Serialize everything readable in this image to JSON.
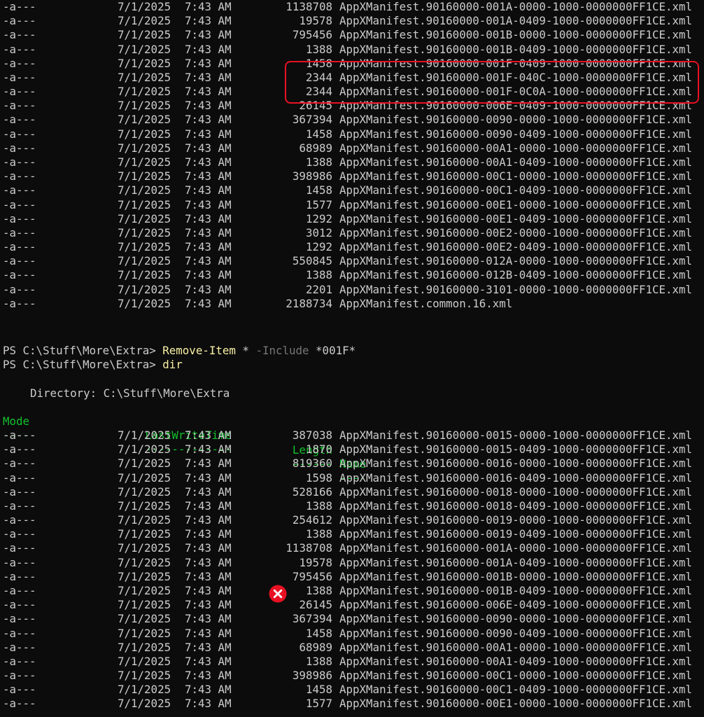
{
  "colors": {
    "background": "#0c0c0c",
    "text": "#cccccc",
    "header_green": "#13c12e",
    "command_yellow": "#f9f1a5",
    "param_gray": "#767676",
    "highlight_red": "#e81123"
  },
  "top_listing": [
    {
      "mode": "-a---",
      "date": "7/1/2025",
      "time": "7:43 AM",
      "length": "1138708",
      "name": "AppXManifest.90160000-001A-0000-1000-0000000FF1CE.xml"
    },
    {
      "mode": "-a---",
      "date": "7/1/2025",
      "time": "7:43 AM",
      "length": "19578",
      "name": "AppXManifest.90160000-001A-0409-1000-0000000FF1CE.xml"
    },
    {
      "mode": "-a---",
      "date": "7/1/2025",
      "time": "7:43 AM",
      "length": "795456",
      "name": "AppXManifest.90160000-001B-0000-1000-0000000FF1CE.xml"
    },
    {
      "mode": "-a---",
      "date": "7/1/2025",
      "time": "7:43 AM",
      "length": "1388",
      "name": "AppXManifest.90160000-001B-0409-1000-0000000FF1CE.xml"
    },
    {
      "mode": "-a---",
      "date": "7/1/2025",
      "time": "7:43 AM",
      "length": "1458",
      "name": "AppXManifest.90160000-001F-0409-1000-0000000FF1CE.xml"
    },
    {
      "mode": "-a---",
      "date": "7/1/2025",
      "time": "7:43 AM",
      "length": "2344",
      "name": "AppXManifest.90160000-001F-040C-1000-0000000FF1CE.xml"
    },
    {
      "mode": "-a---",
      "date": "7/1/2025",
      "time": "7:43 AM",
      "length": "2344",
      "name": "AppXManifest.90160000-001F-0C0A-1000-0000000FF1CE.xml"
    },
    {
      "mode": "-a---",
      "date": "7/1/2025",
      "time": "7:43 AM",
      "length": "26145",
      "name": "AppXManifest.90160000-006E-0409-1000-0000000FF1CE.xml"
    },
    {
      "mode": "-a---",
      "date": "7/1/2025",
      "time": "7:43 AM",
      "length": "367394",
      "name": "AppXManifest.90160000-0090-0000-1000-0000000FF1CE.xml"
    },
    {
      "mode": "-a---",
      "date": "7/1/2025",
      "time": "7:43 AM",
      "length": "1458",
      "name": "AppXManifest.90160000-0090-0409-1000-0000000FF1CE.xml"
    },
    {
      "mode": "-a---",
      "date": "7/1/2025",
      "time": "7:43 AM",
      "length": "68989",
      "name": "AppXManifest.90160000-00A1-0000-1000-0000000FF1CE.xml"
    },
    {
      "mode": "-a---",
      "date": "7/1/2025",
      "time": "7:43 AM",
      "length": "1388",
      "name": "AppXManifest.90160000-00A1-0409-1000-0000000FF1CE.xml"
    },
    {
      "mode": "-a---",
      "date": "7/1/2025",
      "time": "7:43 AM",
      "length": "398986",
      "name": "AppXManifest.90160000-00C1-0000-1000-0000000FF1CE.xml"
    },
    {
      "mode": "-a---",
      "date": "7/1/2025",
      "time": "7:43 AM",
      "length": "1458",
      "name": "AppXManifest.90160000-00C1-0409-1000-0000000FF1CE.xml"
    },
    {
      "mode": "-a---",
      "date": "7/1/2025",
      "time": "7:43 AM",
      "length": "1577",
      "name": "AppXManifest.90160000-00E1-0000-1000-0000000FF1CE.xml"
    },
    {
      "mode": "-a---",
      "date": "7/1/2025",
      "time": "7:43 AM",
      "length": "1292",
      "name": "AppXManifest.90160000-00E1-0409-1000-0000000FF1CE.xml"
    },
    {
      "mode": "-a---",
      "date": "7/1/2025",
      "time": "7:43 AM",
      "length": "3012",
      "name": "AppXManifest.90160000-00E2-0000-1000-0000000FF1CE.xml"
    },
    {
      "mode": "-a---",
      "date": "7/1/2025",
      "time": "7:43 AM",
      "length": "1292",
      "name": "AppXManifest.90160000-00E2-0409-1000-0000000FF1CE.xml"
    },
    {
      "mode": "-a---",
      "date": "7/1/2025",
      "time": "7:43 AM",
      "length": "550845",
      "name": "AppXManifest.90160000-012A-0000-1000-0000000FF1CE.xml"
    },
    {
      "mode": "-a---",
      "date": "7/1/2025",
      "time": "7:43 AM",
      "length": "1388",
      "name": "AppXManifest.90160000-012B-0409-1000-0000000FF1CE.xml"
    },
    {
      "mode": "-a---",
      "date": "7/1/2025",
      "time": "7:43 AM",
      "length": "2201",
      "name": "AppXManifest.90160000-3101-0000-1000-0000000FF1CE.xml"
    },
    {
      "mode": "-a---",
      "date": "7/1/2025",
      "time": "7:43 AM",
      "length": "2188734",
      "name": "AppXManifest.common.16.xml"
    }
  ],
  "command1": {
    "prompt": "PS C:\\Stuff\\More\\Extra> ",
    "cmdlet": "Remove-Item",
    "arg1": " * ",
    "param": "-Include",
    "arg2": " *001F*"
  },
  "command2": {
    "prompt": "PS C:\\Stuff\\More\\Extra> ",
    "cmdlet": "dir"
  },
  "directory_line": "Directory: C:\\Stuff\\More\\Extra",
  "headers": {
    "mode": "Mode",
    "lastwritetime": "LastWriteTime",
    "length": "Length",
    "name": "Name",
    "mode_rule": "----",
    "lastwritetime_rule": "-------------",
    "length_rule": "------",
    "name_rule": "----"
  },
  "bottom_listing": [
    {
      "mode": "-a---",
      "date": "7/1/2025",
      "time": "7:43 AM",
      "length": "387038",
      "name": "AppXManifest.90160000-0015-0000-1000-0000000FF1CE.xml"
    },
    {
      "mode": "-a---",
      "date": "7/1/2025",
      "time": "7:43 AM",
      "length": "1870",
      "name": "AppXManifest.90160000-0015-0409-1000-0000000FF1CE.xml"
    },
    {
      "mode": "-a---",
      "date": "7/1/2025",
      "time": "7:43 AM",
      "length": "819360",
      "name": "AppXManifest.90160000-0016-0000-1000-0000000FF1CE.xml"
    },
    {
      "mode": "-a---",
      "date": "7/1/2025",
      "time": "7:43 AM",
      "length": "1598",
      "name": "AppXManifest.90160000-0016-0409-1000-0000000FF1CE.xml"
    },
    {
      "mode": "-a---",
      "date": "7/1/2025",
      "time": "7:43 AM",
      "length": "528166",
      "name": "AppXManifest.90160000-0018-0000-1000-0000000FF1CE.xml"
    },
    {
      "mode": "-a---",
      "date": "7/1/2025",
      "time": "7:43 AM",
      "length": "1388",
      "name": "AppXManifest.90160000-0018-0409-1000-0000000FF1CE.xml"
    },
    {
      "mode": "-a---",
      "date": "7/1/2025",
      "time": "7:43 AM",
      "length": "254612",
      "name": "AppXManifest.90160000-0019-0000-1000-0000000FF1CE.xml"
    },
    {
      "mode": "-a---",
      "date": "7/1/2025",
      "time": "7:43 AM",
      "length": "1388",
      "name": "AppXManifest.90160000-0019-0409-1000-0000000FF1CE.xml"
    },
    {
      "mode": "-a---",
      "date": "7/1/2025",
      "time": "7:43 AM",
      "length": "1138708",
      "name": "AppXManifest.90160000-001A-0000-1000-0000000FF1CE.xml"
    },
    {
      "mode": "-a---",
      "date": "7/1/2025",
      "time": "7:43 AM",
      "length": "19578",
      "name": "AppXManifest.90160000-001A-0409-1000-0000000FF1CE.xml"
    },
    {
      "mode": "-a---",
      "date": "7/1/2025",
      "time": "7:43 AM",
      "length": "795456",
      "name": "AppXManifest.90160000-001B-0000-1000-0000000FF1CE.xml"
    },
    {
      "mode": "-a---",
      "date": "7/1/2025",
      "time": "7:43 AM",
      "length": "1388",
      "name": "AppXManifest.90160000-001B-0409-1000-0000000FF1CE.xml"
    },
    {
      "mode": "-a---",
      "date": "7/1/2025",
      "time": "7:43 AM",
      "length": "26145",
      "name": "AppXManifest.90160000-006E-0409-1000-0000000FF1CE.xml"
    },
    {
      "mode": "-a---",
      "date": "7/1/2025",
      "time": "7:43 AM",
      "length": "367394",
      "name": "AppXManifest.90160000-0090-0000-1000-0000000FF1CE.xml"
    },
    {
      "mode": "-a---",
      "date": "7/1/2025",
      "time": "7:43 AM",
      "length": "1458",
      "name": "AppXManifest.90160000-0090-0409-1000-0000000FF1CE.xml"
    },
    {
      "mode": "-a---",
      "date": "7/1/2025",
      "time": "7:43 AM",
      "length": "68989",
      "name": "AppXManifest.90160000-00A1-0000-1000-0000000FF1CE.xml"
    },
    {
      "mode": "-a---",
      "date": "7/1/2025",
      "time": "7:43 AM",
      "length": "1388",
      "name": "AppXManifest.90160000-00A1-0409-1000-0000000FF1CE.xml"
    },
    {
      "mode": "-a---",
      "date": "7/1/2025",
      "time": "7:43 AM",
      "length": "398986",
      "name": "AppXManifest.90160000-00C1-0000-1000-0000000FF1CE.xml"
    },
    {
      "mode": "-a---",
      "date": "7/1/2025",
      "time": "7:43 AM",
      "length": "1458",
      "name": "AppXManifest.90160000-00C1-0409-1000-0000000FF1CE.xml"
    },
    {
      "mode": "-a---",
      "date": "7/1/2025",
      "time": "7:43 AM",
      "length": "1577",
      "name": "AppXManifest.90160000-00E1-0000-1000-0000000FF1CE.xml"
    }
  ],
  "annotations": {
    "highlight_box": "red-rounded-rectangle",
    "error_marker": "x-circle-icon"
  }
}
